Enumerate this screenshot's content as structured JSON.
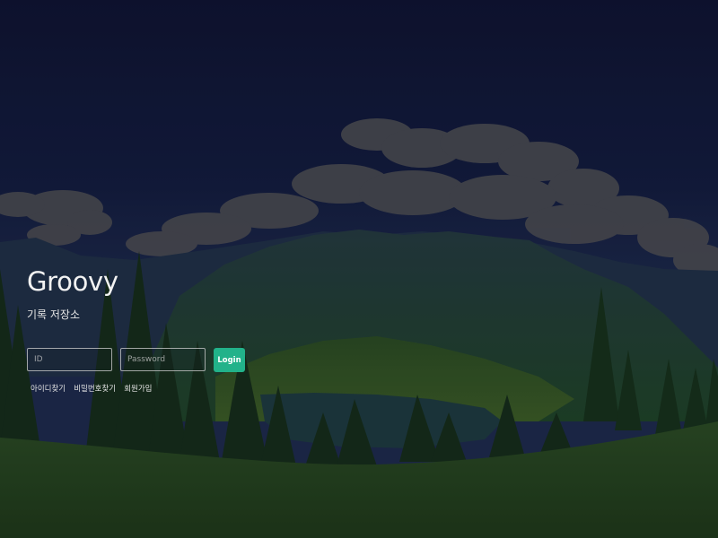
{
  "brand": {
    "title": "Groovy",
    "subtitle": "기록 저장소"
  },
  "login_form": {
    "id_placeholder": "ID",
    "password_placeholder": "Password",
    "login_label": "Login"
  },
  "links": {
    "find_id": "아이디찾기",
    "find_password": "비밀번호찾기",
    "signup": "회원가입"
  },
  "colors": {
    "accent": "#22b28a",
    "sky_dark": "#0f1530",
    "meadow": "#1f3d1b"
  }
}
